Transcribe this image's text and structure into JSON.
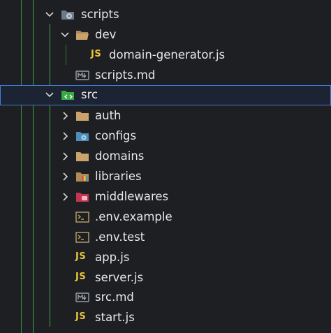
{
  "tree": {
    "items": [
      {
        "label": "scripts",
        "kind": "folder-special",
        "icon": "gear-folder-icon",
        "expanded": true
      },
      {
        "label": "dev",
        "kind": "folder",
        "icon": "folder-open-icon",
        "expanded": true
      },
      {
        "label": "domain-generator.js",
        "kind": "js",
        "icon": "js-file-icon",
        "icon_text": "JS"
      },
      {
        "label": "scripts.md",
        "kind": "markdown",
        "icon": "markdown-file-icon"
      },
      {
        "label": "src",
        "kind": "folder-special",
        "icon": "src-folder-icon",
        "expanded": true,
        "selected": true
      },
      {
        "label": "auth",
        "kind": "folder",
        "icon": "folder-icon",
        "expanded": false
      },
      {
        "label": "configs",
        "kind": "folder-special",
        "icon": "config-folder-icon",
        "expanded": false
      },
      {
        "label": "domains",
        "kind": "folder",
        "icon": "folder-icon",
        "expanded": false
      },
      {
        "label": "libraries",
        "kind": "folder-special",
        "icon": "library-folder-icon",
        "expanded": false
      },
      {
        "label": "middlewares",
        "kind": "folder-special",
        "icon": "middleware-folder-icon",
        "expanded": false
      },
      {
        "label": ".env.example",
        "kind": "env",
        "icon": "terminal-file-icon"
      },
      {
        "label": ".env.test",
        "kind": "env",
        "icon": "terminal-file-icon"
      },
      {
        "label": "app.js",
        "kind": "js",
        "icon": "js-file-icon",
        "icon_text": "JS"
      },
      {
        "label": "server.js",
        "kind": "js",
        "icon": "js-file-icon",
        "icon_text": "JS"
      },
      {
        "label": "src.md",
        "kind": "markdown",
        "icon": "markdown-file-icon"
      },
      {
        "label": "start.js",
        "kind": "js",
        "icon": "js-file-icon",
        "icon_text": "JS"
      }
    ]
  },
  "colors": {
    "background": "#1e1f22",
    "text": "#e8e8e8",
    "folder": "#c9a36b",
    "js": "#e8c53d",
    "selection_border": "#3f7bd6",
    "guide": "#3fa34a"
  }
}
